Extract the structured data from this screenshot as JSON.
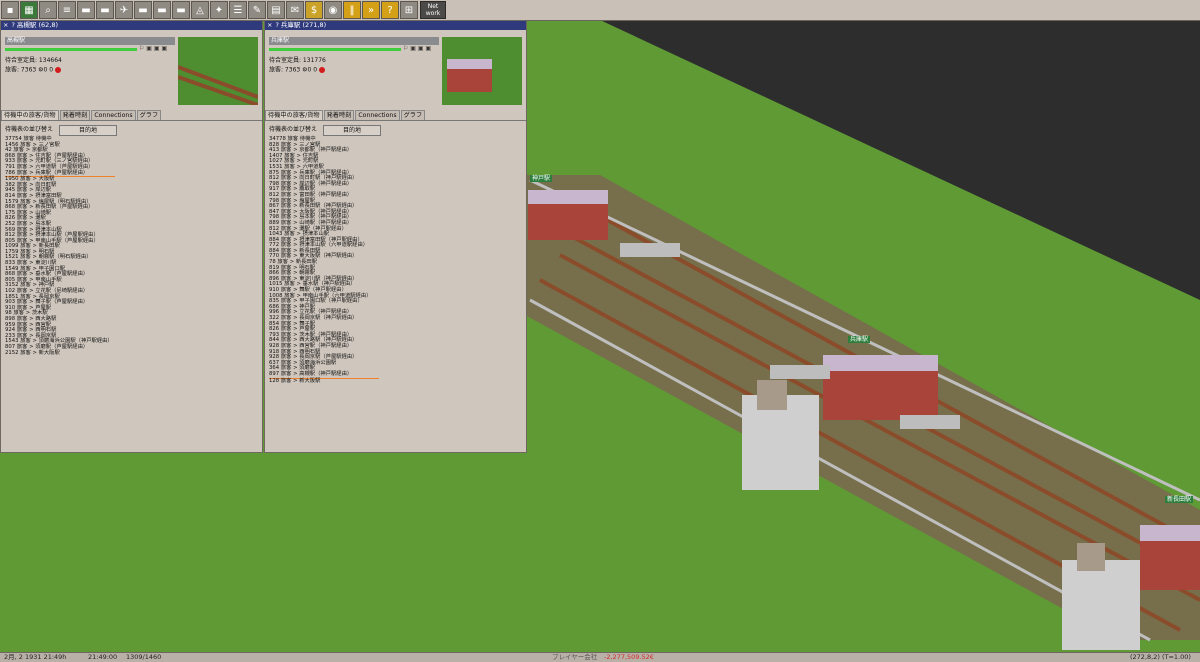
{
  "toolbar": {
    "buttons": [
      "save",
      "map",
      "inspect",
      "rail",
      "road",
      "ship",
      "air",
      "monorail",
      "tram",
      "bus",
      "terrain",
      "misc",
      "list",
      "schedule",
      "journal",
      "mail",
      "money",
      "camera",
      "pause",
      "fastforward",
      "help",
      "grid"
    ],
    "net_label": "Net work"
  },
  "windows": [
    {
      "title": "高槻駅 (62,8)",
      "name": "高槻駅",
      "waiting": "待合室定員: 134664",
      "stats_passengers": "旅客: 7363",
      "stats_zero1": "0",
      "stats_zero2": "0",
      "tabs": [
        "待機中の旅客/貨物",
        "発着時刻",
        "Connections",
        "グラフ"
      ],
      "sort_label": "待機表の並び替え",
      "sort_button": "目的地",
      "list": [
        "37754 旅客  待機中",
        "1456 旅客 > 三ノ宮駅",
        "42 旅客 > 京都駅",
        "868 旅客 > 住吉駅（芦屋駅経由）",
        "933 旅客 > 元町駅（三ノ宮駅経由）",
        "791 旅客 > 六甲道駅（芦屋駅経由）",
        "786 旅客 > 兵庫駅（芦屋駅経由）",
        "1950 旅客 > 大阪駅",
        "382 旅客 > 向日町駅",
        "945 旅客 > 岸辺駅",
        "814 旅客 > 摂津富田駅",
        "1579 旅客 > 塩屋駅（明石駅経由）",
        "868 旅客 > 新長田駅（芦屋駅経由）",
        "175 旅客 > 山崎駅",
        "826 旅客 > 灘駅",
        "252 旅客 > 島本駅",
        "569 旅客 > 摂津本山駅",
        "812 旅客 > 摂津本山駅（芦屋駅経由）",
        "805 旅客 > 甲南山手駅（芦屋駅経由）",
        "1099 旅客 > 新長田駅",
        "1759 旅客 > 明石駅",
        "1521 旅客 > 朝霧駅（明石駅経由）",
        "833 旅客 > 東淀川駅",
        "1549 旅客 > 甲子園口駅",
        "868 旅客 > 垂水駅（芦屋駅経由）",
        "805 旅客 > 甲南山手駅",
        "3152 旅客 > 神戸駅",
        "102 旅客 > 立花駅（尼崎駅経由）",
        "1851 旅客 > 長岡京駅",
        "903 旅客 > 舞子駅（芦屋駅経由）",
        "910 旅客 > 芦屋駅",
        "98 旅客 > 茨木駅",
        "898 旅客 > 西大路駅",
        "959 旅客 > 西宮駅",
        "924 旅客 > 西明石駅",
        "233 旅客 > 長岡京駅",
        "1543 旅客 > 須磨海浜公園駅（神戸駅経由）",
        "807 旅客 > 須磨駅（芦屋駅経由）",
        "2152 旅客 > 新大阪駅"
      ],
      "highlight_index": 6
    },
    {
      "title": "兵庫駅 (271,8)",
      "name": "兵庫駅",
      "waiting": "待合室定員: 131776",
      "stats_passengers": "旅客: 7363",
      "stats_zero1": "0",
      "stats_zero2": "0",
      "tabs": [
        "待機中の旅客/貨物",
        "発着時刻",
        "Connections",
        "グラフ"
      ],
      "sort_label": "待機表の並び替え",
      "sort_button": "目的地",
      "list": [
        "34778 旅客  待機中",
        "828 旅客 > 三ノ宮駅",
        "413 旅客 > 京都駅（神戸駅経由）",
        "1407 旅客 > 住吉駅",
        "1027 旅客 > 元町駅",
        "1531 旅客 > 六甲道駅",
        "875 旅客 > 兵庫駅（神戸駅経由）",
        "812 旅客 > 向日町駅（神戸駅経由）",
        "798 旅客 > 岸辺駅（神戸駅経由）",
        "917 旅客 > 鷹取駅",
        "812 旅客 > 富田駅（神戸駅経由）",
        "798 旅客 > 塩屋駅",
        "867 旅客 > 新長田駅（神戸駅経由）",
        "847 旅客 > 大阪駅（神戸駅経由）",
        "798 旅客 > 島本駅（神戸駅経由）",
        "889 旅客 > 山崎駅（神戸駅経由）",
        "812 旅客 > 灘駅（神戸駅経由）",
        "1043 旅客 > 摂津本山駅",
        "884 旅客 > 摂津富田駅（神戸駅経由）",
        "772 旅客 > 摂津本山駅（六甲道駅経由）",
        "884 旅客 > 新長田駅",
        "770 旅客 > 東大阪駅（神戸駅経由）",
        "78 旅客 > 新長田駅",
        "819 旅客 > 明石駅",
        "866 旅客 > 朝霧駅",
        "896 旅客 > 東淀川駅（神戸駅経由）",
        "1015 旅客 > 垂水駅（神戸駅経由）",
        "910 旅客 > 舞駅（神戸駅経由）",
        "1008 旅客 > 甲南山手駅（六甲道駅経由）",
        "835 旅客 > 甲子園口駅（神戸駅経由）",
        "686 旅客 > 神戸駅",
        "996 旅客 > 立花駅（神戸駅経由）",
        "322 旅客 > 長岡京駅（神戸駅経由）",
        "854 旅客 > 舞子駅",
        "826 旅客 > 芦屋駅",
        "793 旅客 > 茨木駅（神戸駅経由）",
        "844 旅客 > 西大路駅（神戸駅経由）",
        "928 旅客 > 西宮駅（神戸駅経由）",
        "918 旅客 > 西明石駅",
        "928 旅客 > 長岡京駅（芦屋駅経由）",
        "637 旅客 > 須磨海浜公園駅",
        "364 旅客 > 須磨駅",
        "897 旅客 > 高槻駅（神戸駅経由）",
        "128 旅客 > 新大阪駅"
      ],
      "highlight_index": 42
    }
  ],
  "map_signs": [
    "神戸駅",
    "兵庫駅",
    "新長田駅"
  ],
  "status": {
    "date": "2月, 2 1931 21:49h",
    "time": "21:49:00",
    "ratio": "1309/1460",
    "player": "プレイヤー会社",
    "money": "-2,277,509.52€",
    "coords": "(272,8,2) (T=1.00)"
  },
  "colors": {
    "money": "#d22b2b",
    "title": "#2f3a7d",
    "grass": "#5f9a35"
  }
}
